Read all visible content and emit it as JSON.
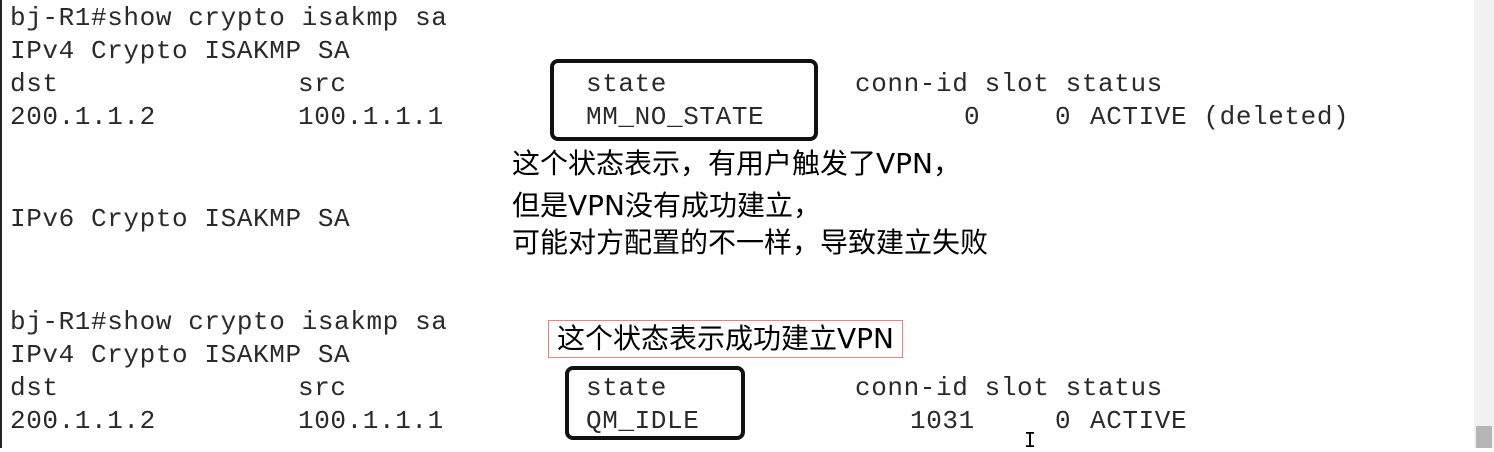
{
  "block1": {
    "prompt": "bj-R1#show crypto isakmp sa",
    "section_v4": "IPv4 Crypto ISAKMP SA",
    "headers": {
      "dst": "dst",
      "src": "src",
      "state": "state",
      "conn_slot_status": "conn-id slot status"
    },
    "row": {
      "dst": "200.1.1.2",
      "src": "100.1.1.1",
      "state": "MM_NO_STATE",
      "conn_id": "0",
      "slot": "0",
      "status": "ACTIVE (deleted)"
    },
    "section_v6": "IPv6 Crypto ISAKMP SA"
  },
  "annotation1": {
    "line1": "这个状态表示，有用户触发了VPN，",
    "line2": "但是VPN没有成功建立，",
    "line3": "可能对方配置的不一样，导致建立失败"
  },
  "block2": {
    "prompt": "bj-R1#show crypto isakmp sa",
    "section_v4": "IPv4 Crypto ISAKMP SA",
    "headers": {
      "dst": "dst",
      "src": "src",
      "state": "state",
      "conn_slot_status": "conn-id slot status"
    },
    "row": {
      "dst": "200.1.1.2",
      "src": "100.1.1.1",
      "state": "QM_IDLE",
      "conn_id": "1031",
      "slot": "0",
      "status": "ACTIVE"
    }
  },
  "annotation2": {
    "text": "这个状态表示成功建立VPN"
  },
  "cursor": "I"
}
